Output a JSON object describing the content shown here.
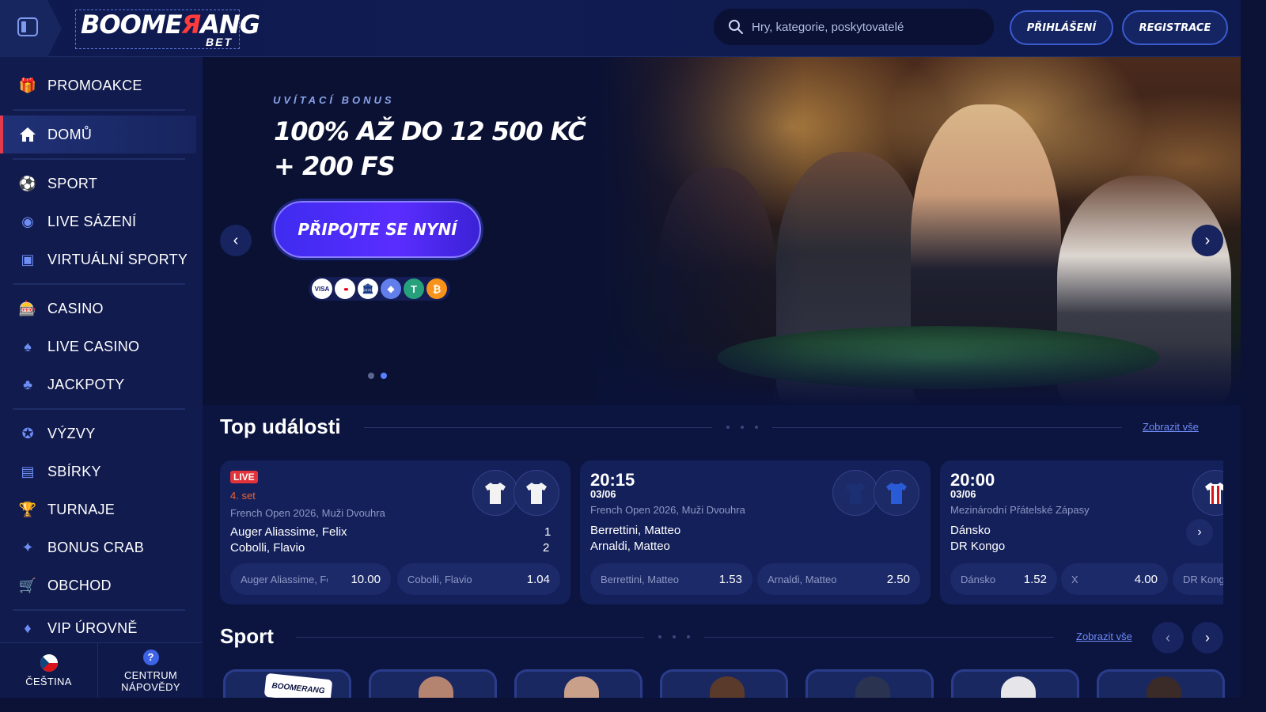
{
  "header": {
    "logo_main": "BOOMERANG",
    "logo_sub": "BET",
    "search_placeholder": "Hry, kategorie, poskytovatelé",
    "login_label": "PŘIHLÁŠENÍ",
    "register_label": "REGISTRACE"
  },
  "sidebar": {
    "items": [
      {
        "label": "PROMOAKCE",
        "icon": "gift-icon",
        "glyph": "🎁"
      },
      {
        "label": "DOMŮ",
        "icon": "home-icon",
        "glyph": "⌂",
        "active": true
      },
      {
        "label": "SPORT",
        "icon": "soccer-ball-icon",
        "glyph": "⚽"
      },
      {
        "label": "LIVE SÁZENÍ",
        "icon": "live-broadcast-icon",
        "glyph": "◉"
      },
      {
        "label": "VIRTUÁLNÍ SPORTY",
        "icon": "virtual-sports-icon",
        "glyph": "▣"
      },
      {
        "label": "CASINO",
        "icon": "slot-machine-icon",
        "glyph": "🎰"
      },
      {
        "label": "LIVE CASINO",
        "icon": "playing-card-icon",
        "glyph": "♠"
      },
      {
        "label": "JACKPOTY",
        "icon": "clover-icon",
        "glyph": "♣"
      },
      {
        "label": "VÝZVY",
        "icon": "medal-icon",
        "glyph": "✪"
      },
      {
        "label": "SBÍRKY",
        "icon": "collection-icon",
        "glyph": "▤"
      },
      {
        "label": "TURNAJE",
        "icon": "trophy-icon",
        "glyph": "🏆"
      },
      {
        "label": "BONUS CRAB",
        "icon": "claw-icon",
        "glyph": "✦"
      },
      {
        "label": "OBCHOD",
        "icon": "shop-icon",
        "glyph": "🛒"
      },
      {
        "label": "VIP ÚROVNĚ",
        "icon": "diamond-icon",
        "glyph": "♦"
      }
    ],
    "language_label": "ČEŠTINA",
    "help_label_1": "CENTRUM",
    "help_label_2": "NÁPOVĚDY",
    "help_glyph": "?"
  },
  "hero": {
    "eyebrow": "UVÍTACÍ BONUS",
    "title": "100% AŽ DO 12 500 KČ + 200 FS",
    "cta": "PŘIPOJTE SE NYNÍ",
    "payments": [
      {
        "name": "visa-icon",
        "text": "VISA",
        "bg": "#ffffff",
        "fg": "#1a1f71"
      },
      {
        "name": "mastercard-icon",
        "text": "●●",
        "bg": "#ffffff",
        "fg": "#eb001b"
      },
      {
        "name": "bank-icon",
        "text": "🏛",
        "bg": "#ffffff",
        "fg": "#1a3a8a"
      },
      {
        "name": "ethereum-icon",
        "text": "◆",
        "bg": "#627eea",
        "fg": "#ffffff"
      },
      {
        "name": "tether-icon",
        "text": "T",
        "bg": "#26a17b",
        "fg": "#ffffff"
      },
      {
        "name": "bitcoin-icon",
        "text": "₿",
        "bg": "#f7931a",
        "fg": "#ffffff"
      }
    ],
    "slide_count": 2,
    "active_slide": 2
  },
  "top_events": {
    "title": "Top události",
    "see_all": "Zobrazit vše",
    "cards": [
      {
        "live_label": "LIVE",
        "status": "4. set",
        "league": "French Open 2026, Muži Dvouhra",
        "home": "Auger Aliassime, Felix",
        "away": "Cobolli, Flavio",
        "home_score": "1",
        "away_score": "2",
        "odds": [
          {
            "name": "Auger Aliassime, Felix",
            "value": "10.00"
          },
          {
            "name": "Cobolli, Flavio",
            "value": "1.04"
          }
        ]
      },
      {
        "time": "20:15",
        "date": "03/06",
        "league": "French Open 2026, Muži Dvouhra",
        "home": "Berrettini, Matteo",
        "away": "Arnaldi, Matteo",
        "odds": [
          {
            "name": "Berrettini, Matteo",
            "value": "1.53"
          },
          {
            "name": "Arnaldi, Matteo",
            "value": "2.50"
          }
        ]
      },
      {
        "time": "20:00",
        "date": "03/06",
        "league": "Mezinárodní Přátelské Zápasy",
        "home": "Dánsko",
        "away": "DR Kongo",
        "odds": [
          {
            "name": "Dánsko",
            "value": "1.52"
          },
          {
            "name": "X",
            "value": "4.00"
          },
          {
            "name": "DR Kongo",
            "value": ""
          }
        ]
      }
    ]
  },
  "sport": {
    "title": "Sport",
    "see_all": "Zobrazit vše",
    "tile_logo": "BOOMERANG"
  }
}
